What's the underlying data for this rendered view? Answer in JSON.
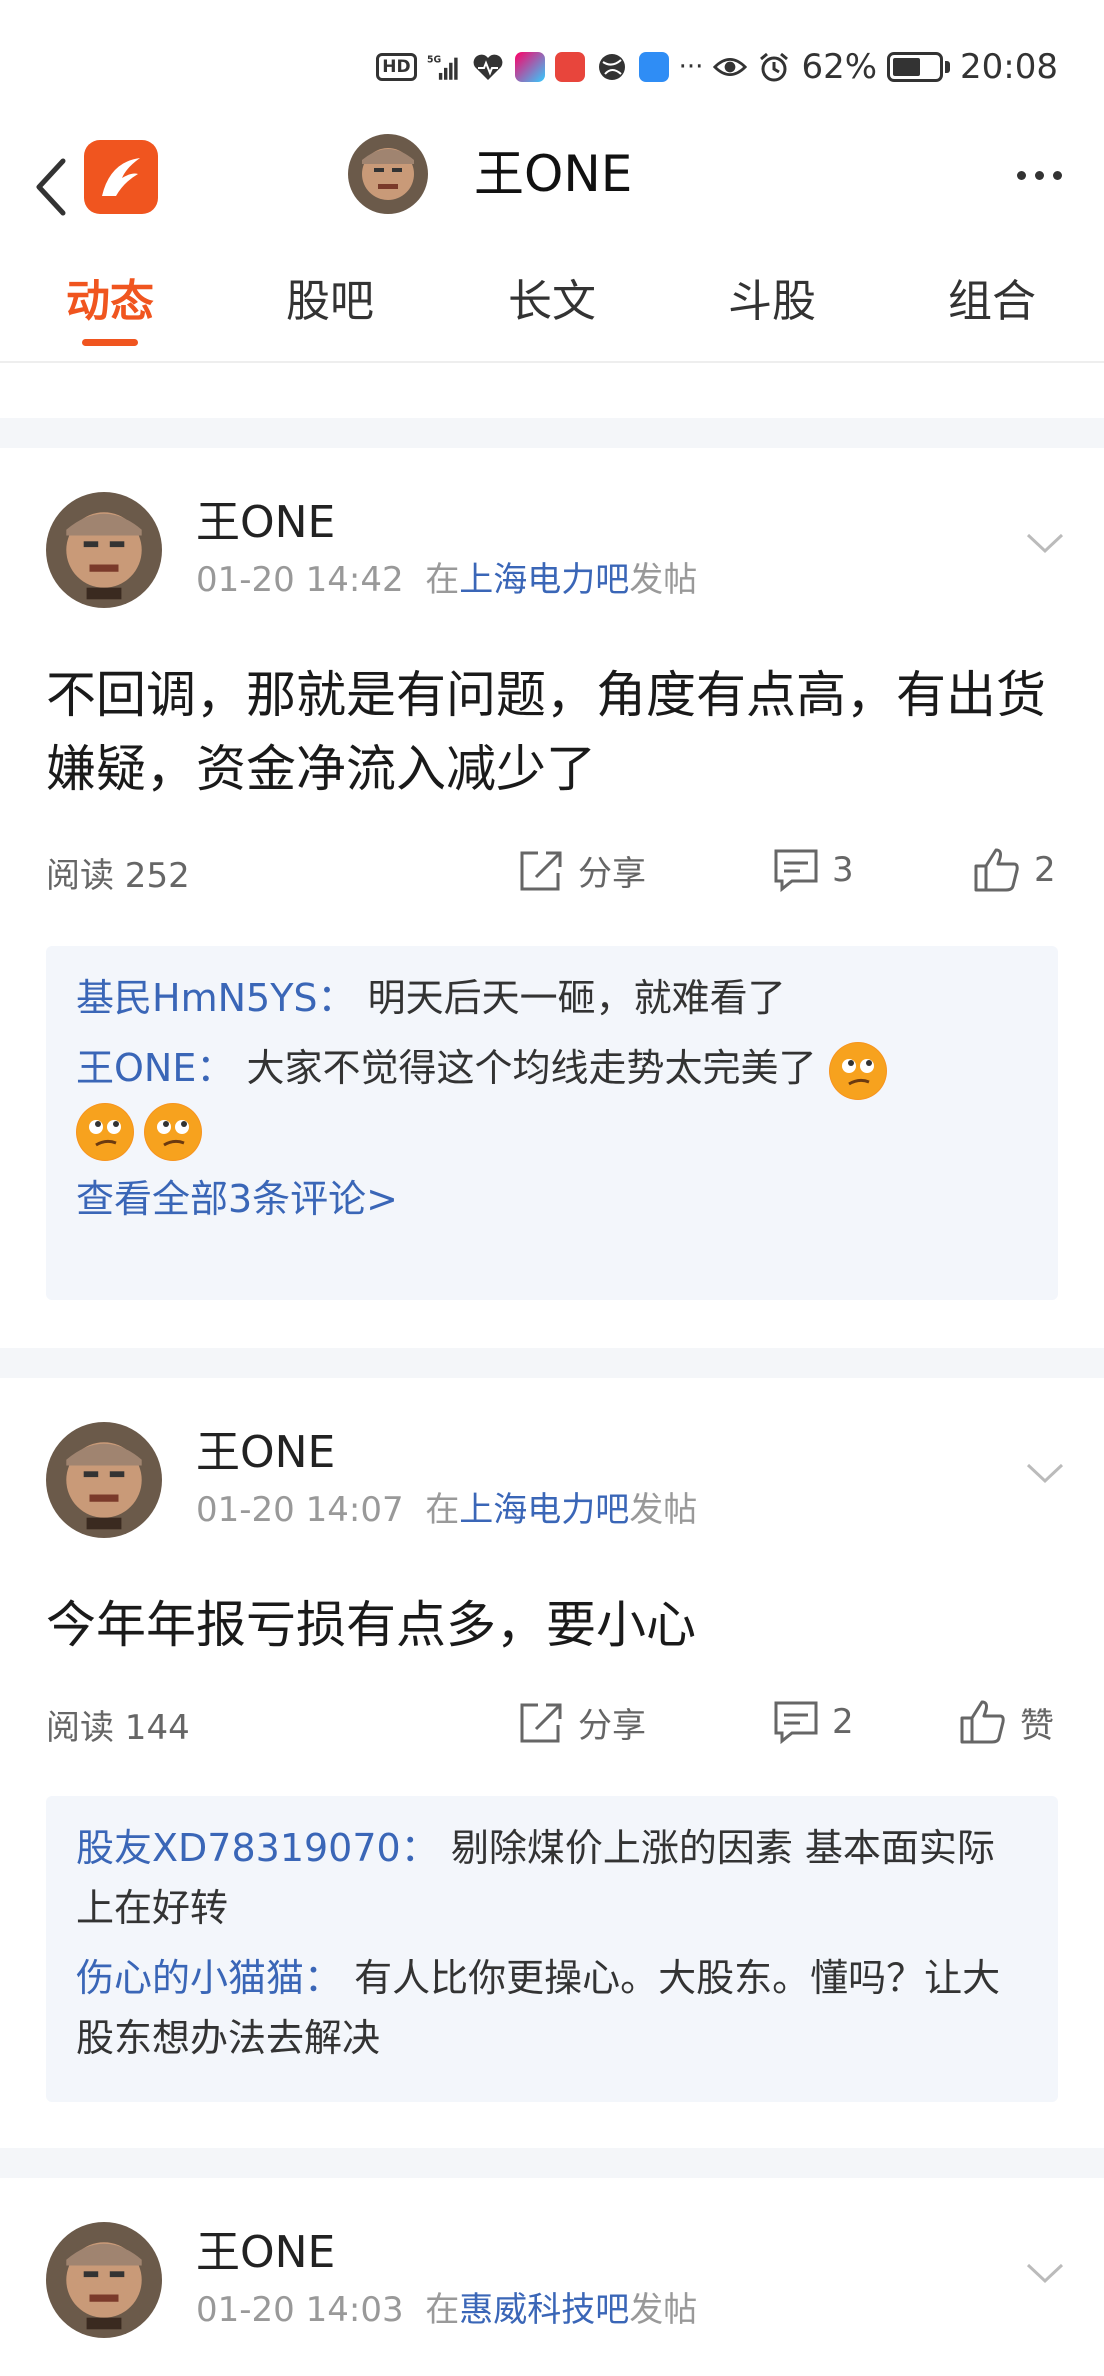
{
  "status_bar": {
    "hd": "HD",
    "network": "5G",
    "battery_percent": "62%",
    "battery_level": 0.62,
    "time": "20:08",
    "more": "···"
  },
  "header": {
    "title": "王ONE"
  },
  "tabs": [
    {
      "label": "动态",
      "active": true
    },
    {
      "label": "股吧",
      "active": false
    },
    {
      "label": "长文",
      "active": false
    },
    {
      "label": "斗股",
      "active": false
    },
    {
      "label": "组合",
      "active": false
    }
  ],
  "posts": [
    {
      "author": "王ONE",
      "time": "01-20 14:42",
      "prefix": "在",
      "bar": "上海电力吧",
      "suffix": "发帖",
      "body": "不回调，那就是有问题，角度有点高，有出货嫌疑，资金净流入减少了",
      "read_label": "阅读 252",
      "share": "分享",
      "comment_count": "3",
      "like": "2",
      "comments": [
        {
          "who": "基民HmN5YS：",
          "text": "明天后天一砸，就难看了"
        },
        {
          "who": "王ONE：",
          "text": "大家不觉得这个均线走势太完美了"
        }
      ],
      "view_all": "查看全部3条评论>"
    },
    {
      "author": "王ONE",
      "time": "01-20 14:07",
      "prefix": "在",
      "bar": "上海电力吧",
      "suffix": "发帖",
      "body": "今年年报亏损有点多，要小心",
      "read_label": "阅读 144",
      "share": "分享",
      "comment_count": "2",
      "like": "赞",
      "comments": [
        {
          "who": "股友XD78319070：",
          "text": "剔除煤价上涨的因素 基本面实际上在好转"
        },
        {
          "who": "伤心的小猫猫：",
          "text": "有人比你更操心。大股东。懂吗？让大股东想办法去解决"
        }
      ]
    },
    {
      "author": "王ONE",
      "time": "01-20 14:03",
      "prefix": "在",
      "bar": "惠威科技吧",
      "suffix": "发帖"
    }
  ]
}
